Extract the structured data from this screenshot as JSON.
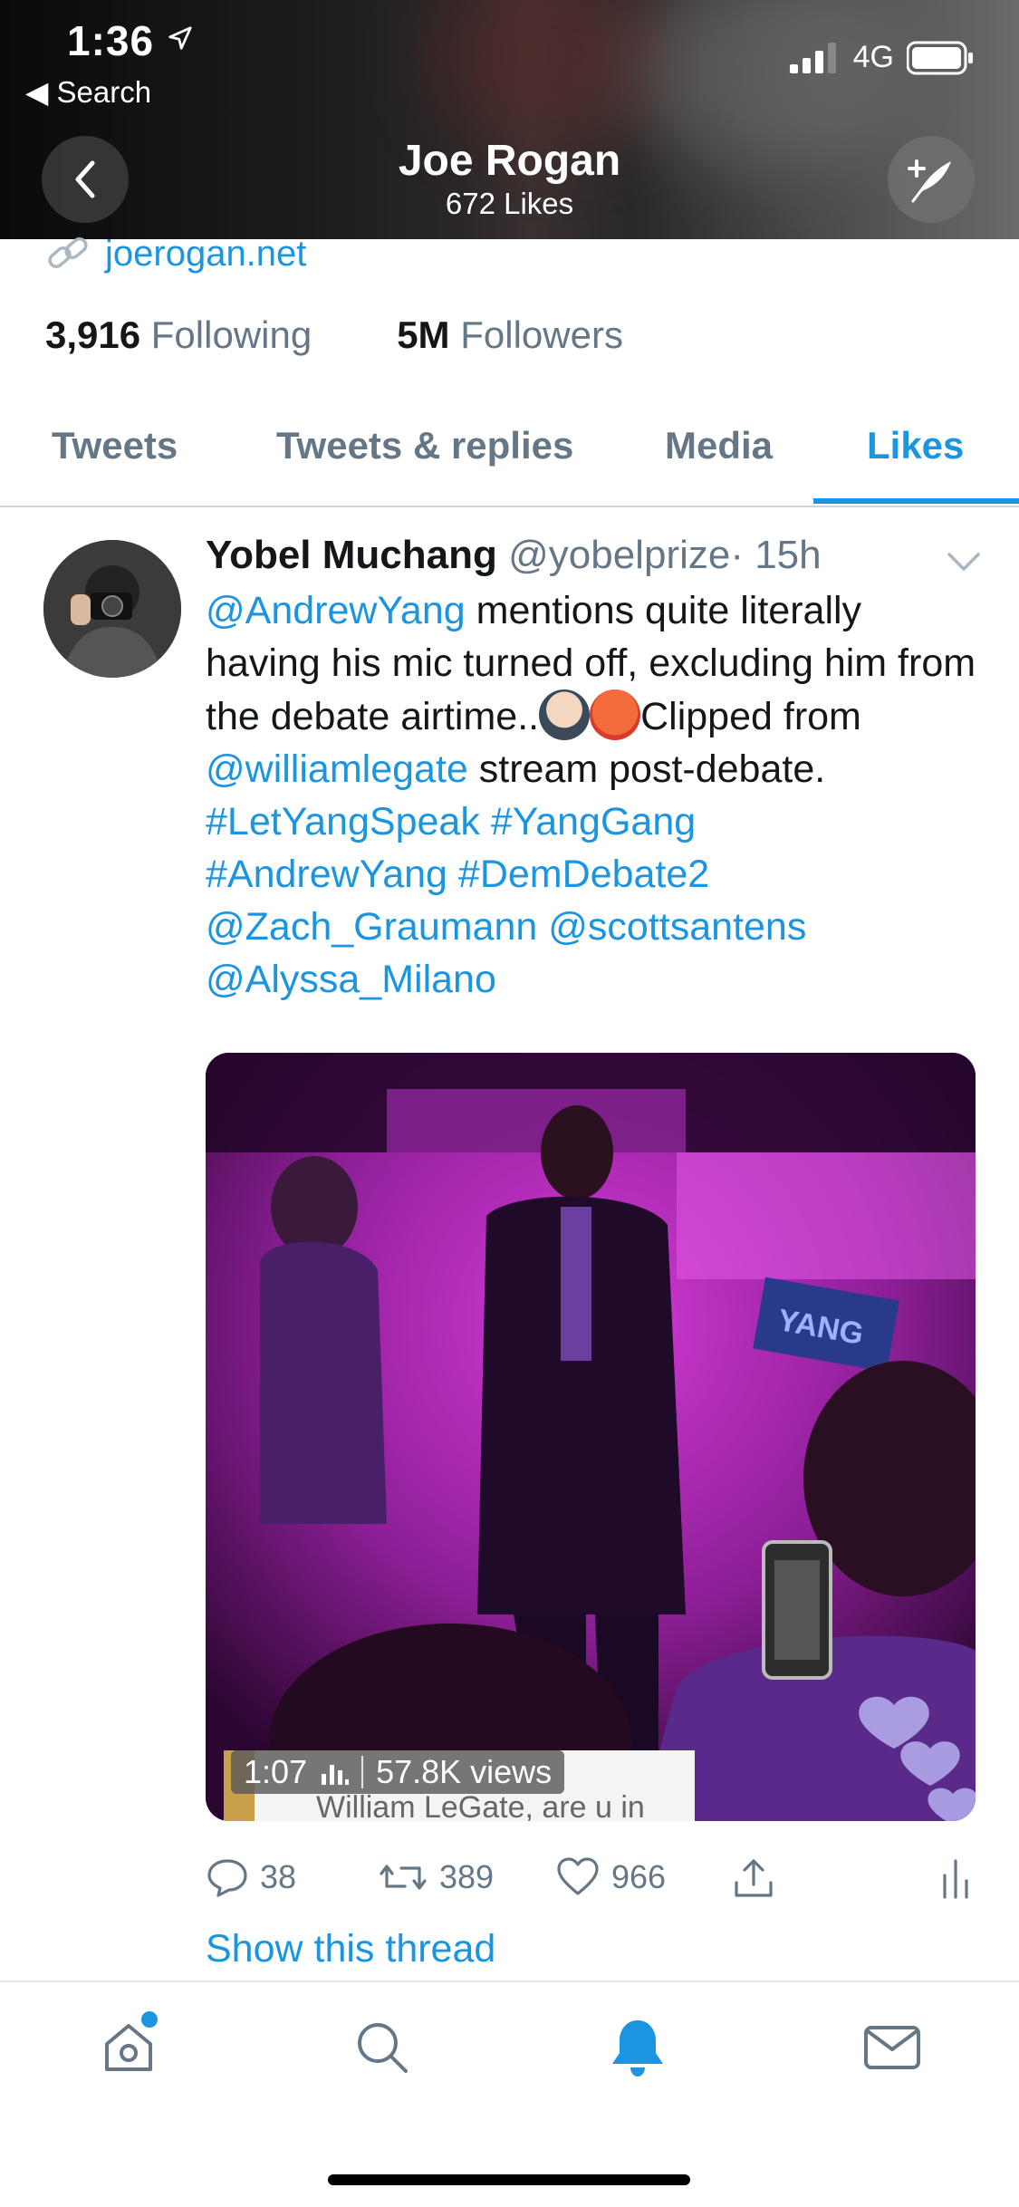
{
  "status_bar": {
    "time": "1:36",
    "back_label": "◀ Search",
    "network": "4G"
  },
  "header": {
    "title": "Joe Rogan",
    "subtitle": "672 Likes"
  },
  "profile": {
    "link": "joerogan.net",
    "following_count": "3,916",
    "following_label": "Following",
    "followers_count": "5M",
    "followers_label": "Followers"
  },
  "tabs": [
    {
      "label": "Tweets"
    },
    {
      "label": "Tweets & replies"
    },
    {
      "label": "Media"
    },
    {
      "label": "Likes"
    }
  ],
  "tweet": {
    "name": "Yobel Muchang",
    "handle": "@yobelprize",
    "time": "· 15h",
    "segments": {
      "s1": "@AndrewYang",
      "s2": " mentions quite literally having his mic turned off, excluding him from the debate airtime..",
      "s3": "Clipped from ",
      "s4": "@williamlegate",
      "s5": " stream post-debate. ",
      "s6": "#LetYangSpeak",
      "s7": " ",
      "s8": "#YangGang",
      "s9": "#AndrewYang",
      "s10": " ",
      "s11": "#DemDebate2",
      "s12": "@Zach_Graumann",
      "s13": " ",
      "s14": "@scottsantens",
      "s15": "@Alyssa_Milano"
    },
    "video": {
      "duration": "1:07",
      "views": "57.8K views",
      "caption": "William LeGate, are u in",
      "sign_text": "YANG"
    },
    "actions": {
      "replies": "38",
      "retweets": "389",
      "likes": "966"
    },
    "show_thread": "Show this thread"
  },
  "colors": {
    "accent": "#1b95e0",
    "text": "#14171a",
    "secondary": "#657786"
  }
}
